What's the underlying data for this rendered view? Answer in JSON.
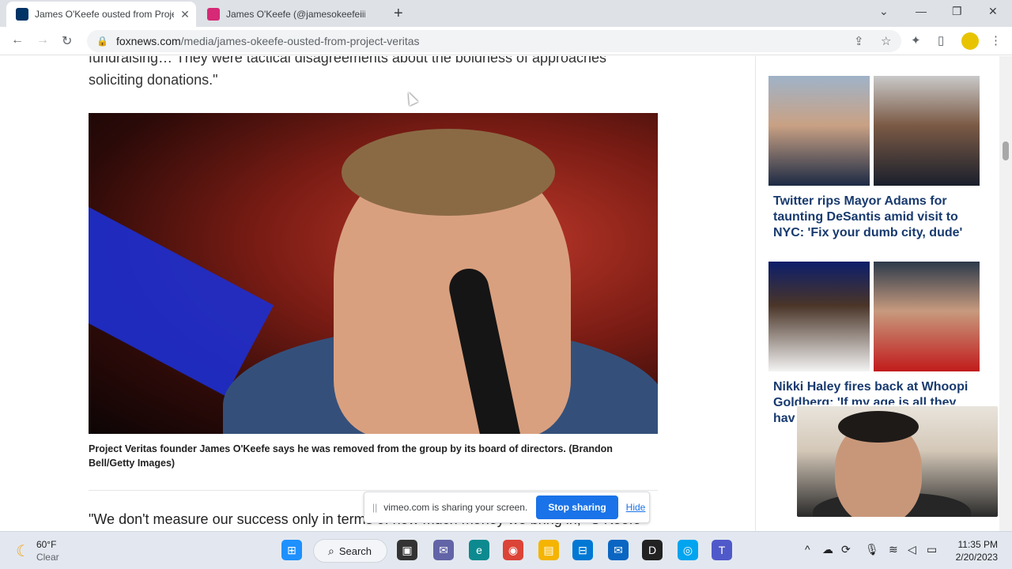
{
  "browser": {
    "tabs": [
      {
        "title": "James O'Keefe ousted from Proje",
        "active": true,
        "favicon_color": "#003366"
      },
      {
        "title": "James O'Keefe (@jamesokeefeiii)",
        "active": false,
        "favicon_color": "#d62976"
      }
    ],
    "new_tab": "+",
    "controls": {
      "minimize": "—",
      "restore": "❐",
      "close": "✕",
      "dropdown": "⌄"
    },
    "url_host": "foxnews.com",
    "url_path": "/media/james-okeefe-ousted-from-project-veritas"
  },
  "article": {
    "text_top_line1": "fundraising… They were tactical disagreements about the boldness of approaches",
    "text_top_line2": "soliciting donations.\"",
    "caption": "Project Veritas founder James O'Keefe says he was removed from the group by its board of directors. (Brandon Bell/Getty Images)",
    "quote_start": "\"We don't measure our success only in terms of how much money we bring in,\" O'Keefe"
  },
  "sidebar": {
    "cards": [
      {
        "headline": "Twitter rips Mayor Adams for taunting DeSantis amid visit to NYC: 'Fix your dumb city, dude'"
      },
      {
        "headline": "Nikki Haley fires back at Whoopi Goldberg: 'If my age is all they have"
      }
    ]
  },
  "share_bar": {
    "message": "vimeo.com is sharing your screen.",
    "stop_label": "Stop sharing",
    "hide_label": "Hide"
  },
  "taskbar": {
    "weather_temp": "60°F",
    "weather_cond": "Clear",
    "search_label": "Search",
    "time": "11:35 PM",
    "date": "2/20/2023"
  },
  "colors": {
    "accent": "#1a73e8",
    "headline": "#183a6e"
  }
}
